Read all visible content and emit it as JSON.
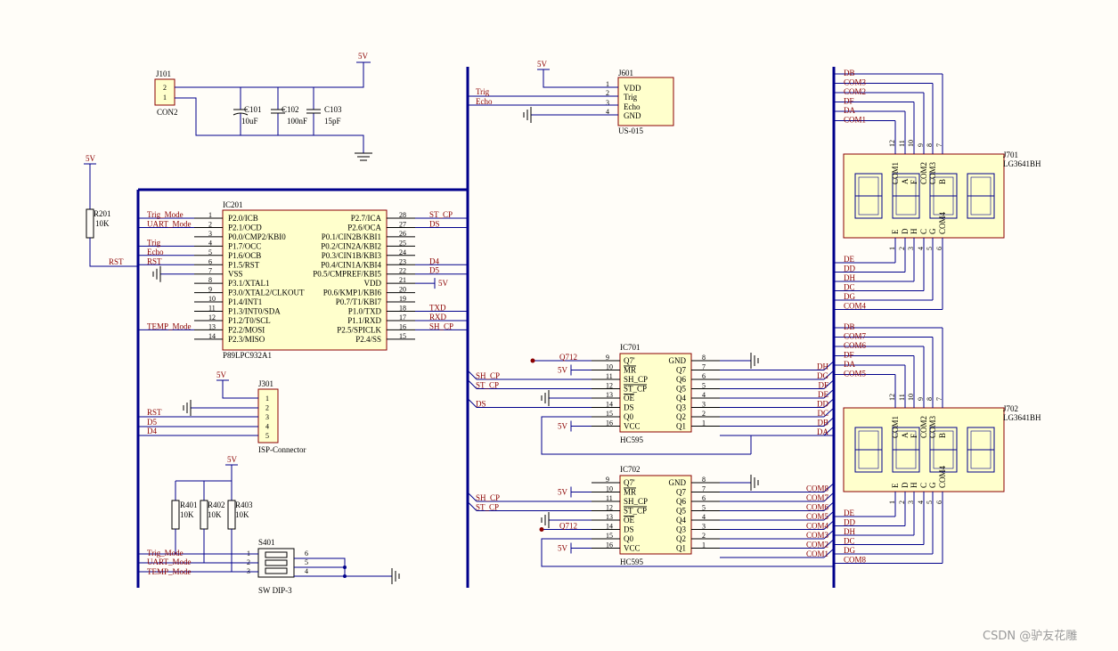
{
  "watermark": "CSDN @驴友花雕",
  "power": {
    "vcc": "5V"
  },
  "j101": {
    "ref": "J101",
    "value": "CON2",
    "pins": [
      "2",
      "1"
    ]
  },
  "caps": [
    {
      "ref": "C101",
      "value": "10uF"
    },
    {
      "ref": "C102",
      "value": "100nF"
    },
    {
      "ref": "C103",
      "value": "15pF"
    }
  ],
  "j601": {
    "ref": "J601",
    "value": "US-015",
    "pins": [
      {
        "num": "1",
        "name": "VDD"
      },
      {
        "num": "2",
        "name": "Trig"
      },
      {
        "num": "3",
        "name": "Echo"
      },
      {
        "num": "4",
        "name": "GND"
      }
    ],
    "nets": [
      "Trig",
      "Echo"
    ]
  },
  "r201": {
    "ref": "R201",
    "value": "10K",
    "net": "RST"
  },
  "ic201": {
    "ref": "IC201",
    "value": "P89LPC932A1",
    "left_pins": [
      {
        "num": "1",
        "name": "P2.0/ICB",
        "net": "Trig_Mode"
      },
      {
        "num": "2",
        "name": "P2.1/OCD",
        "net": "UART_Mode"
      },
      {
        "num": "3",
        "name": "P0.0/CMP2/KBI0",
        "net": ""
      },
      {
        "num": "4",
        "name": "P1.7/OCC",
        "net": "Trig"
      },
      {
        "num": "5",
        "name": "P1.6/OCB",
        "net": "Echo"
      },
      {
        "num": "6",
        "name": "P1.5/RST",
        "net": "RST"
      },
      {
        "num": "7",
        "name": "VSS",
        "net": ""
      },
      {
        "num": "8",
        "name": "P3.1/XTAL1",
        "net": ""
      },
      {
        "num": "9",
        "name": "P3.0/XTAL2/CLKOUT",
        "net": ""
      },
      {
        "num": "10",
        "name": "P1.4/INT1",
        "net": ""
      },
      {
        "num": "11",
        "name": "P1.3/INT0/SDA",
        "net": ""
      },
      {
        "num": "12",
        "name": "P1.2/T0/SCL",
        "net": ""
      },
      {
        "num": "13",
        "name": "P2.2/MOSI",
        "net": "TEMP_Mode"
      },
      {
        "num": "14",
        "name": "P2.3/MISO",
        "net": ""
      }
    ],
    "right_pins": [
      {
        "num": "28",
        "name": "P2.7/ICA",
        "net": "ST_CP"
      },
      {
        "num": "27",
        "name": "P2.6/OCA",
        "net": "DS"
      },
      {
        "num": "26",
        "name": "P0.1/CIN2B/KBI1",
        "net": ""
      },
      {
        "num": "25",
        "name": "P0.2/CIN2A/KBI2",
        "net": ""
      },
      {
        "num": "24",
        "name": "P0.3/CIN1B/KBI3",
        "net": ""
      },
      {
        "num": "23",
        "name": "P0.4/CIN1A/KBI4",
        "net": "D4"
      },
      {
        "num": "22",
        "name": "P0.5/CMPREF/KBI5",
        "net": "D5"
      },
      {
        "num": "21",
        "name": "VDD",
        "net": "5V"
      },
      {
        "num": "20",
        "name": "P0.6/KMP1/KBI6",
        "net": ""
      },
      {
        "num": "19",
        "name": "P0.7/T1/KBI7",
        "net": ""
      },
      {
        "num": "18",
        "name": "P1.0/TXD",
        "net": "TXD"
      },
      {
        "num": "17",
        "name": "P1.1/RXD",
        "net": "RXD"
      },
      {
        "num": "16",
        "name": "P2.5/SPICLK",
        "net": "SH_CP"
      },
      {
        "num": "15",
        "name": "P2.4/SS",
        "net": ""
      }
    ]
  },
  "j301": {
    "ref": "J301",
    "value": "ISP-Connector",
    "pins": [
      "1",
      "2",
      "3",
      "4",
      "5"
    ],
    "nets": [
      "RST",
      "D5",
      "D4"
    ]
  },
  "pullups": [
    {
      "ref": "R401",
      "value": "10K"
    },
    {
      "ref": "R402",
      "value": "10K"
    },
    {
      "ref": "R403",
      "value": "10K"
    }
  ],
  "s401": {
    "ref": "S401",
    "value": "SW DIP-3",
    "left_pins": [
      "1",
      "2",
      "3"
    ],
    "right_pins": [
      "6",
      "5",
      "4"
    ],
    "nets": [
      "Trig_Mode",
      "UART_Mode",
      "TEMP_Mode"
    ]
  },
  "ic701": {
    "ref": "IC701",
    "value": "HC595",
    "left_pins": [
      {
        "num": "9",
        "name": "Q7'"
      },
      {
        "num": "10",
        "name": "MR"
      },
      {
        "num": "11",
        "name": "SH_CP"
      },
      {
        "num": "12",
        "name": "ST_CP"
      },
      {
        "num": "13",
        "name": "OE"
      },
      {
        "num": "14",
        "name": "DS"
      },
      {
        "num": "15",
        "name": "Q0"
      },
      {
        "num": "16",
        "name": "VCC"
      }
    ],
    "right_pins": [
      {
        "num": "8",
        "name": "GND"
      },
      {
        "num": "7",
        "name": "Q7"
      },
      {
        "num": "6",
        "name": "Q6"
      },
      {
        "num": "5",
        "name": "Q5"
      },
      {
        "num": "4",
        "name": "Q4"
      },
      {
        "num": "3",
        "name": "Q3"
      },
      {
        "num": "2",
        "name": "Q2"
      },
      {
        "num": "1",
        "name": "Q1"
      }
    ],
    "in_nets": [
      "Q712",
      "5V",
      "SH_CP",
      "ST_CP",
      "DS"
    ],
    "out_nets": [
      "DH",
      "DG",
      "DF",
      "DE",
      "DD",
      "DC",
      "DB",
      "DA"
    ]
  },
  "ic702": {
    "ref": "IC702",
    "value": "HC595",
    "in_nets": [
      "5V",
      "SH_CP",
      "ST_CP",
      "Q712"
    ],
    "out_nets": [
      "COM8",
      "COM7",
      "COM6",
      "COM5",
      "COM4",
      "COM3",
      "COM2",
      "COM1"
    ]
  },
  "j701": {
    "ref": "J701",
    "value": "LG3641BH",
    "top_nets": [
      "DB",
      "COM3",
      "COM2",
      "DF",
      "DA",
      "COM1"
    ],
    "bottom_nets": [
      "DE",
      "DD",
      "DH",
      "DC",
      "DG",
      "COM4"
    ],
    "top_pins": [
      "12",
      "11",
      "10",
      "9",
      "8",
      "7"
    ],
    "bottom_pins": [
      "1",
      "2",
      "3",
      "4",
      "5",
      "6"
    ],
    "top_labels": [
      "COM1",
      "A",
      "F",
      "COM2",
      "COM3",
      "B"
    ],
    "bottom_labels": [
      "E",
      "D",
      "H",
      "C",
      "G",
      "COM4"
    ]
  },
  "j702": {
    "ref": "J702",
    "value": "LG3641BH",
    "top_nets": [
      "DB",
      "COM7",
      "COM6",
      "DF",
      "DA",
      "COM5"
    ],
    "bottom_nets": [
      "DE",
      "DD",
      "DH",
      "DC",
      "DG",
      "COM8"
    ],
    "top_pins": [
      "12",
      "11",
      "10",
      "9",
      "8",
      "7"
    ],
    "bottom_pins": [
      "1",
      "2",
      "3",
      "4",
      "5",
      "6"
    ],
    "top_labels": [
      "COM1",
      "A",
      "F",
      "COM2",
      "COM3",
      "B"
    ],
    "bottom_labels": [
      "E",
      "D",
      "H",
      "C",
      "G",
      "COM4"
    ]
  }
}
